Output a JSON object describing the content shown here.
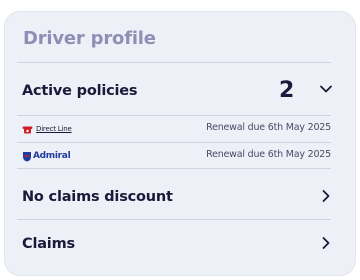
{
  "profile": {
    "title": "Driver profile"
  },
  "active_policies": {
    "label": "Active policies",
    "count": "2",
    "expand_icon": "chevron-down-icon",
    "policies": [
      {
        "insurer": "Direct Line",
        "logo_icon": "red-telephone-icon",
        "renewal": "Renewal due 6th May 2025"
      },
      {
        "insurer": "Admiral",
        "logo_icon": "admiral-badge-icon",
        "renewal": "Renewal due 6th May 2025"
      }
    ]
  },
  "no_claims": {
    "label": "No claims discount",
    "nav_icon": "chevron-right-icon"
  },
  "claims": {
    "label": "Claims",
    "nav_icon": "chevron-right-icon"
  },
  "colors": {
    "card_background": "#eef0f7",
    "title": "#8f8fb6",
    "primary_text": "#1a1a3a",
    "divider": "#d2d3dd",
    "direct_line_red": "#d0202a",
    "admiral_blue": "#1f3aa0"
  }
}
